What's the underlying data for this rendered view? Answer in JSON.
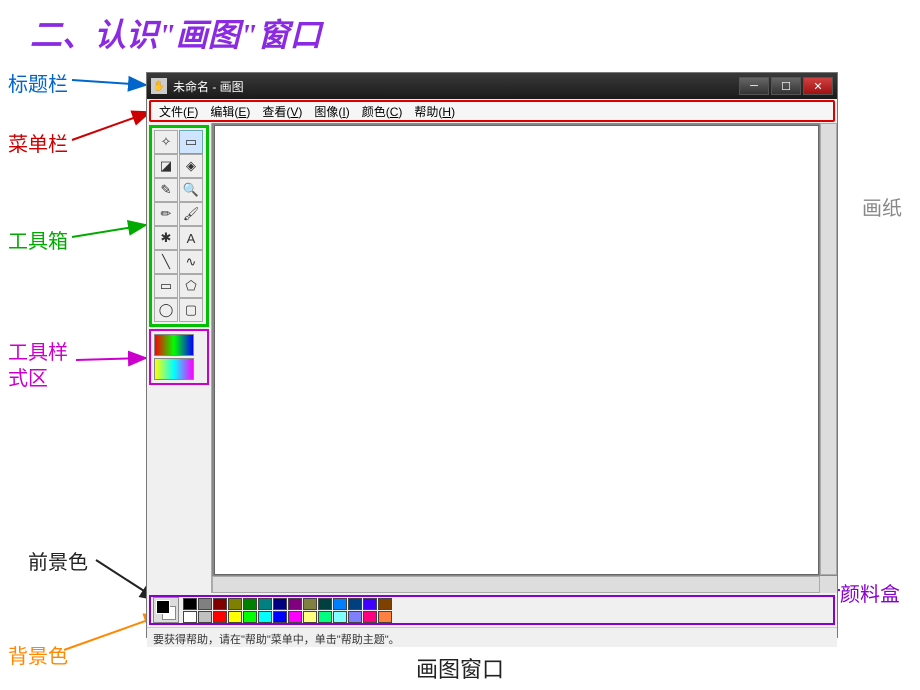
{
  "heading": "二、认识\"画图\"窗口",
  "caption": "画图窗口",
  "labels": {
    "titlebar": "标题栏",
    "menubar": "菜单栏",
    "toolbox": "工具箱",
    "toolstyle": "工具样\n式区",
    "foreground": "前景色",
    "background": "背景色",
    "palette": "颜料盒",
    "canvas_paper": "画纸"
  },
  "window": {
    "title": "未命名 - 画图",
    "menus": [
      {
        "label": "文件",
        "mnemonic": "F"
      },
      {
        "label": "编辑",
        "mnemonic": "E"
      },
      {
        "label": "查看",
        "mnemonic": "V"
      },
      {
        "label": "图像",
        "mnemonic": "I"
      },
      {
        "label": "颜色",
        "mnemonic": "C"
      },
      {
        "label": "帮助",
        "mnemonic": "H"
      }
    ],
    "tools": [
      {
        "name": "free-select",
        "glyph": "✧"
      },
      {
        "name": "rect-select",
        "glyph": "▭"
      },
      {
        "name": "eraser",
        "glyph": "◪"
      },
      {
        "name": "fill",
        "glyph": "◈"
      },
      {
        "name": "picker",
        "glyph": "✎"
      },
      {
        "name": "magnifier",
        "glyph": "🔍"
      },
      {
        "name": "pencil",
        "glyph": "✏"
      },
      {
        "name": "brush",
        "glyph": "🖌"
      },
      {
        "name": "airbrush",
        "glyph": "✱"
      },
      {
        "name": "text",
        "glyph": "A"
      },
      {
        "name": "line",
        "glyph": "╲"
      },
      {
        "name": "curve",
        "glyph": "∿"
      },
      {
        "name": "rectangle",
        "glyph": "▭"
      },
      {
        "name": "polygon",
        "glyph": "⬠"
      },
      {
        "name": "ellipse",
        "glyph": "◯"
      },
      {
        "name": "round-rect",
        "glyph": "▢"
      }
    ],
    "palette_row1": [
      "#000000",
      "#808080",
      "#800000",
      "#808000",
      "#008000",
      "#008080",
      "#000080",
      "#800080",
      "#808040",
      "#004040",
      "#0080ff",
      "#004080",
      "#4000ff",
      "#804000"
    ],
    "palette_row2": [
      "#ffffff",
      "#c0c0c0",
      "#ff0000",
      "#ffff00",
      "#00ff00",
      "#00ffff",
      "#0000ff",
      "#ff00ff",
      "#ffff80",
      "#00ff80",
      "#80ffff",
      "#8080ff",
      "#ff0080",
      "#ff8040"
    ],
    "statusbar": "要获得帮助，请在\"帮助\"菜单中，单击\"帮助主题\"。"
  }
}
